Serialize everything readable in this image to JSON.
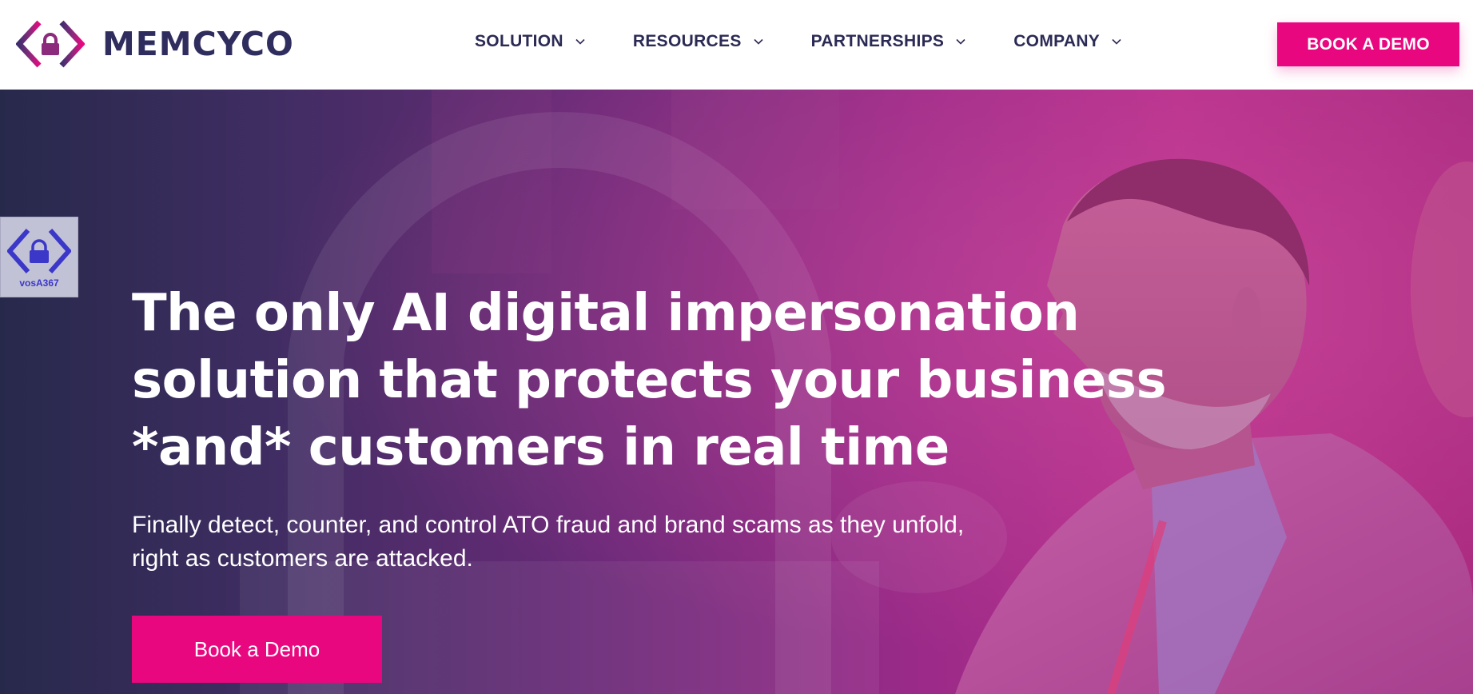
{
  "brand": {
    "name": "MEMCYCO",
    "logo_icon": "brackets-lock-icon"
  },
  "nav": {
    "items": [
      {
        "label": "SOLUTION",
        "icon": "chevron-down-icon"
      },
      {
        "label": "RESOURCES",
        "icon": "chevron-down-icon"
      },
      {
        "label": "PARTNERSHIPS",
        "icon": "chevron-down-icon"
      },
      {
        "label": "COMPANY",
        "icon": "chevron-down-icon"
      }
    ],
    "cta_label": "BOOK A DEMO"
  },
  "hero": {
    "title_lines": [
      "The only AI digital impersonation",
      "solution that protects your business",
      "*and* customers in real time"
    ],
    "subtitle": "Finally detect, counter, and control ATO fraud and brand scams as they unfold, right as customers are attacked.",
    "cta_label": "Book a Demo",
    "background_image": "man-in-suit-photo-with-pink-overlay"
  },
  "badge": {
    "label": "vosA367",
    "icon": "brackets-lock-icon"
  },
  "colors": {
    "accent": "#e8077f",
    "brand_navy": "#2b2a55",
    "logo_purple": "#3f2d6d",
    "hero_dark": "#27294b",
    "hero_pink": "#b72f8c",
    "badge_blue": "#3b37c9"
  }
}
